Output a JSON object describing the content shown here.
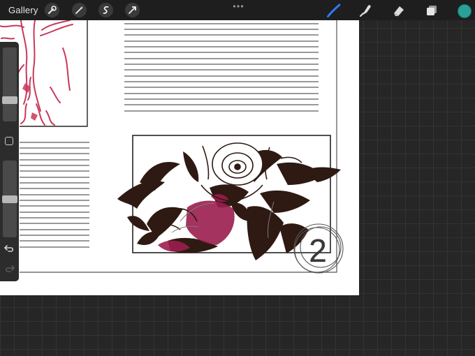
{
  "topbar": {
    "gallery_label": "Gallery",
    "left_tools": [
      "wrench-icon",
      "magic-wand-icon",
      "selection-icon",
      "transform-arrow-icon"
    ],
    "right_tools": [
      "brush-icon",
      "smudge-icon",
      "eraser-icon",
      "layers-icon"
    ],
    "active_tool": "brush-icon",
    "current_color": "#2aa198"
  },
  "sidebar": {
    "brush_size_level": 0.55,
    "opacity_level": 0.5,
    "buttons": [
      "modify-button",
      "undo-icon",
      "redo-icon"
    ]
  },
  "canvas": {
    "panel_number": "2",
    "ink_colors": {
      "red_sketch": "#c8385a",
      "dark_ink": "#2e1a12",
      "magenta": "#9b1e4e"
    }
  }
}
